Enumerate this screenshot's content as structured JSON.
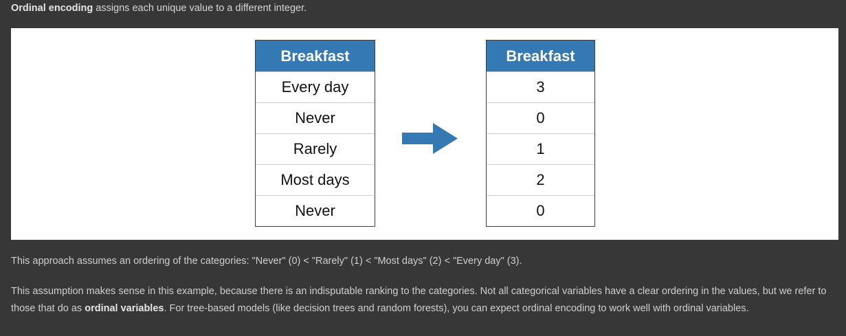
{
  "intro": {
    "term": "Ordinal encoding",
    "rest": " assigns each unique value to a different integer."
  },
  "figure": {
    "left_table": {
      "header": "Breakfast",
      "rows": [
        "Every day",
        "Never",
        "Rarely",
        "Most days",
        "Never"
      ]
    },
    "arrow_icon": "right-arrow-icon",
    "right_table": {
      "header": "Breakfast",
      "rows": [
        "3",
        "0",
        "1",
        "2",
        "0"
      ]
    },
    "colors": {
      "header_bg": "#3478b4",
      "arrow": "#3478b4",
      "page_bg": "#373737"
    }
  },
  "paragraph1": "This approach assumes an ordering of the categories: \"Never\" (0) < \"Rarely\" (1) < \"Most days\" (2) < \"Every day\" (3).",
  "paragraph2": {
    "part1": "This assumption makes sense in this example, because there is an indisputable ranking to the categories. Not all categorical variables have a clear ordering in the values, but we refer to those that do as ",
    "bold": "ordinal variables",
    "part2": ". For tree-based models (like decision trees and random forests), you can expect ordinal encoding to work well with ordinal variables."
  }
}
